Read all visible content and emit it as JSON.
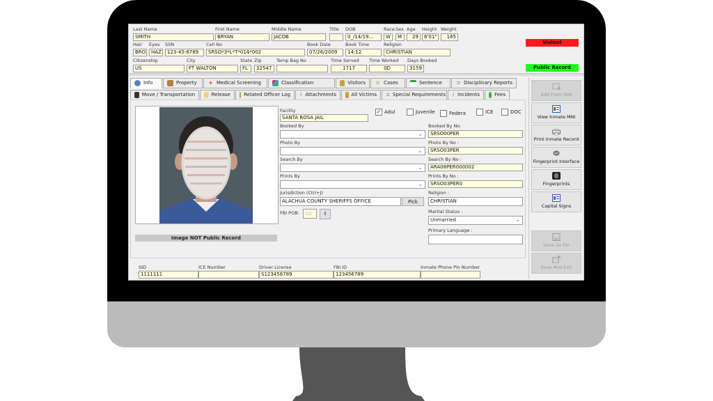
{
  "header": {
    "last_name": {
      "label": "Last Name",
      "value": "SMITH"
    },
    "first_name": {
      "label": "First Name",
      "value": "BRYAN"
    },
    "middle_name": {
      "label": "Middle Name",
      "value": "JACOB"
    },
    "title": {
      "label": "Title",
      "value": ""
    },
    "dob": {
      "label": "DOB",
      "value": "0_/14/19..."
    },
    "race": {
      "label": "Race",
      "value": "W"
    },
    "sex": {
      "label": "Sex",
      "value": "M"
    },
    "age": {
      "label": "Age",
      "value": "29"
    },
    "height": {
      "label": "Height",
      "value": "6'01\""
    },
    "weight": {
      "label": "Weight",
      "value": "165"
    },
    "hair": {
      "label": "Hair",
      "value": "BRO"
    },
    "eyes": {
      "label": "Eyes",
      "value": "HAZ"
    },
    "ssn": {
      "label": "SSN",
      "value": "123-45-6789"
    },
    "cell_no": {
      "label": "Cell No",
      "value": "SRSO*3*L*T*014*002"
    },
    "book_date": {
      "label": "Book Date",
      "value": "07/26/2009"
    },
    "book_time": {
      "label": "Book Time",
      "value": "14:12"
    },
    "religion": {
      "label": "Religion",
      "value": "CHRISTIAN"
    },
    "citizenship": {
      "label": "Citizenship",
      "value": "US"
    },
    "city": {
      "label": "City",
      "value": "FT WALTON"
    },
    "state": {
      "label": "State",
      "value": "FL"
    },
    "zip": {
      "label": "Zip",
      "value": "32547"
    },
    "temp_bag_no": {
      "label": "Temp Bag No",
      "value": ""
    },
    "time_served": {
      "label": "Time Served",
      "value": "1717"
    },
    "time_worked": {
      "label": "Time Worked",
      "value": "0D"
    },
    "days_booked": {
      "label": "Days Booked",
      "value": "3159"
    },
    "badges": {
      "violent": {
        "label": "Violent",
        "color": "#ff1a1a"
      },
      "public_record": {
        "label": "Public Record",
        "color": "#1aff1a"
      }
    }
  },
  "tabs_row1": [
    {
      "label": "Info",
      "icon": "user-icon",
      "active": true
    },
    {
      "label": "Property",
      "icon": "box-icon"
    },
    {
      "label": "Medical Screening",
      "icon": "medical-icon"
    },
    {
      "label": "Classification",
      "icon": "classification-icon"
    },
    {
      "label": "Visitors",
      "icon": "visitors-icon"
    },
    {
      "label": "Cases",
      "icon": "scales-icon"
    },
    {
      "label": "Sentence",
      "icon": "calendar-icon"
    },
    {
      "label": "Disciplinary Reports",
      "icon": "handcuffs-icon"
    }
  ],
  "tabs_row2": [
    {
      "label": "Move / Transportation",
      "icon": "bus-icon"
    },
    {
      "label": "Release",
      "icon": "hand-icon"
    },
    {
      "label": "Related Officer Log",
      "icon": "log-icon"
    },
    {
      "label": "Attachments",
      "icon": "paperclip-icon"
    },
    {
      "label": "All Victims",
      "icon": "victims-icon"
    },
    {
      "label": "Special Requirements",
      "icon": "handcuffs-icon"
    },
    {
      "label": "Incidents",
      "icon": "pen-icon"
    },
    {
      "label": "Fees",
      "icon": "money-icon"
    }
  ],
  "info": {
    "photo_caption": "Image NOT Public Record",
    "facility": {
      "label": "Facility",
      "value": "SANTA ROSA JAIL"
    },
    "checkboxes": [
      {
        "label": "Adul",
        "checked": true
      },
      {
        "label": "Juvenile",
        "checked": false
      },
      {
        "label": "Federa",
        "checked": false
      },
      {
        "label": "ICE",
        "checked": false
      },
      {
        "label": "DOC",
        "checked": false
      }
    ],
    "booked_by": {
      "label": "Booked By",
      "value": ""
    },
    "booked_by_no": {
      "label": "Booked By No.",
      "value": "SRSO00PER"
    },
    "photo_by": {
      "label": "Photo By",
      "value": ""
    },
    "photo_by_no": {
      "label": "Photo By No :",
      "value": "SRSO03PER"
    },
    "search_by": {
      "label": "Search By",
      "value": ""
    },
    "search_by_no": {
      "label": "Search By No :",
      "value": "ARA08PER000002"
    },
    "prints_by": {
      "label": "Prints By",
      "value": ""
    },
    "prints_by_no": {
      "label": "Prints By No :",
      "value": "SRSO03PER0"
    },
    "jurisdiction": {
      "label": "Jurisdiction (Ctrl+J)",
      "value": "ALACHUA COUNTY SHERIFFS OFFICE",
      "pick_label": "Pick"
    },
    "religion": {
      "label": "Religion :",
      "value": "CHRISTIAN"
    },
    "fbi_pob": {
      "label": "FBI POB:",
      "value": "SD"
    },
    "marital_status": {
      "label": "Marital Status :",
      "value": "Unmarried"
    },
    "primary_language": {
      "label": "Primary Language :",
      "value": ""
    }
  },
  "bottom": {
    "sid": {
      "label": "SID",
      "value": "1111111"
    },
    "ice_number": {
      "label": "ICE Number",
      "value": ""
    },
    "driver_license": {
      "label": "Driver License",
      "value": "S123456789"
    },
    "fbi_id": {
      "label": "FBI ID",
      "value": "123456789"
    },
    "phone_pin": {
      "label": "Inmate Phone Pin Number",
      "value": ""
    }
  },
  "side_buttons": [
    {
      "label": "Add From MNI",
      "icon": "add-mni-icon",
      "enabled": false
    },
    {
      "label": "View Inmate MNI",
      "icon": "id-card-icon",
      "enabled": true
    },
    {
      "label": "Print Inmate Record",
      "icon": "printer-icon",
      "enabled": true
    },
    {
      "label": "Fingerprint Interface",
      "icon": "fingerprint-scanner-icon",
      "enabled": true
    },
    {
      "label": "Fingerprints",
      "icon": "fingerprint-icon",
      "enabled": true
    },
    {
      "label": "Capital Signs",
      "icon": "id-card-icon",
      "enabled": true
    },
    {
      "label": "Save So Far",
      "icon": "save-icon",
      "enabled": false
    },
    {
      "label": "Save And Exit",
      "icon": "save-exit-icon",
      "enabled": false
    }
  ]
}
